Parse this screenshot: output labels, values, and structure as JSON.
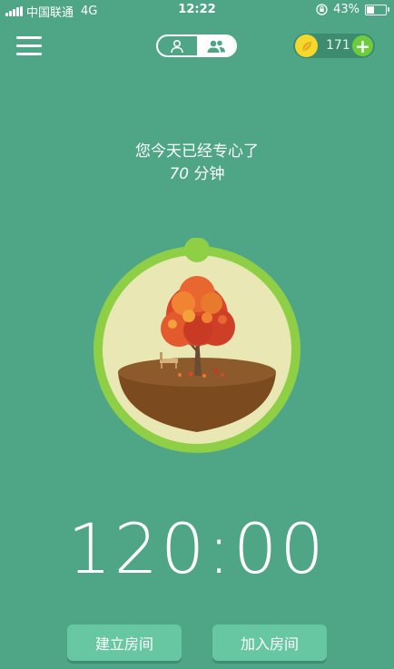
{
  "status_bar": {
    "carrier": "中国联通",
    "network": "4G",
    "time": "12:22",
    "battery": "43%",
    "battery_level": 0.43
  },
  "header": {
    "menu_icon": "hamburger-menu-icon",
    "mode_toggle": {
      "options": [
        "single-person-icon",
        "group-icon"
      ],
      "selected": "group-icon"
    },
    "coins": {
      "count": "171",
      "coin_icon": "coin-leaf-icon",
      "add_icon": "plus-icon"
    }
  },
  "focus": {
    "line1": "您今天已经专心了",
    "minutes": "70",
    "unit": "分钟"
  },
  "timer": "120:00",
  "buttons": {
    "create_room": "建立房间",
    "join_room": "加入房间"
  },
  "colors": {
    "background": "#4fa687",
    "ring": "#8fcf45",
    "tree": "#d9482b",
    "button": "#66c7a2"
  }
}
